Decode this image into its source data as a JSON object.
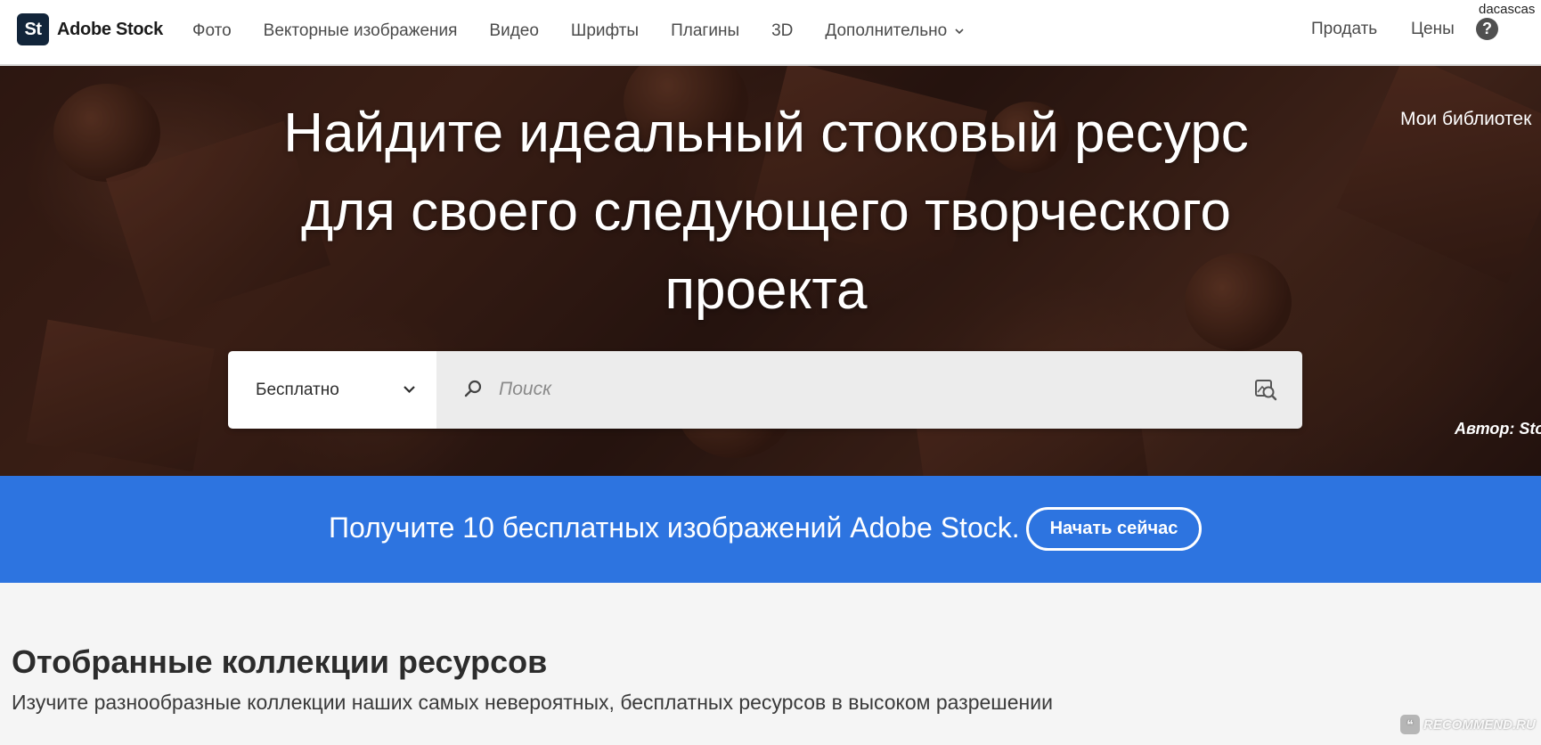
{
  "header": {
    "logo_badge": "St",
    "logo_text": "Adobe Stock",
    "nav": [
      "Фото",
      "Векторные изображения",
      "Видео",
      "Шрифты",
      "Плагины",
      "3D"
    ],
    "nav_more": "Дополнительно",
    "sell": "Продать",
    "prices": "Цены",
    "help": "?",
    "user": "dacascas"
  },
  "hero": {
    "title_lines": [
      "Найдите идеальный стоковый ресурс",
      "для своего следующего творческого",
      "проекта"
    ],
    "side_link": "Мои библиотек",
    "credit": "Автор: Sto",
    "search": {
      "filter_value": "Бесплатно",
      "placeholder": "Поиск"
    }
  },
  "promo": {
    "text": "Получите 10 бесплатных изображений Adobe Stock.",
    "button": "Начать сейчас"
  },
  "collections": {
    "title": "Отобранные коллекции ресурсов",
    "subtitle": "Изучите разнообразные коллекции наших самых невероятных, бесплатных ресурсов в высоком разрешении"
  },
  "watermark": {
    "text": "RECOMMEND.RU"
  },
  "colors": {
    "promo_blue": "#2d74e0",
    "logo_navy": "#12253a",
    "hero_brown": "#3a1f17"
  },
  "icons": [
    "chevron-down-icon",
    "search-icon",
    "visual-search-icon",
    "help-icon"
  ]
}
